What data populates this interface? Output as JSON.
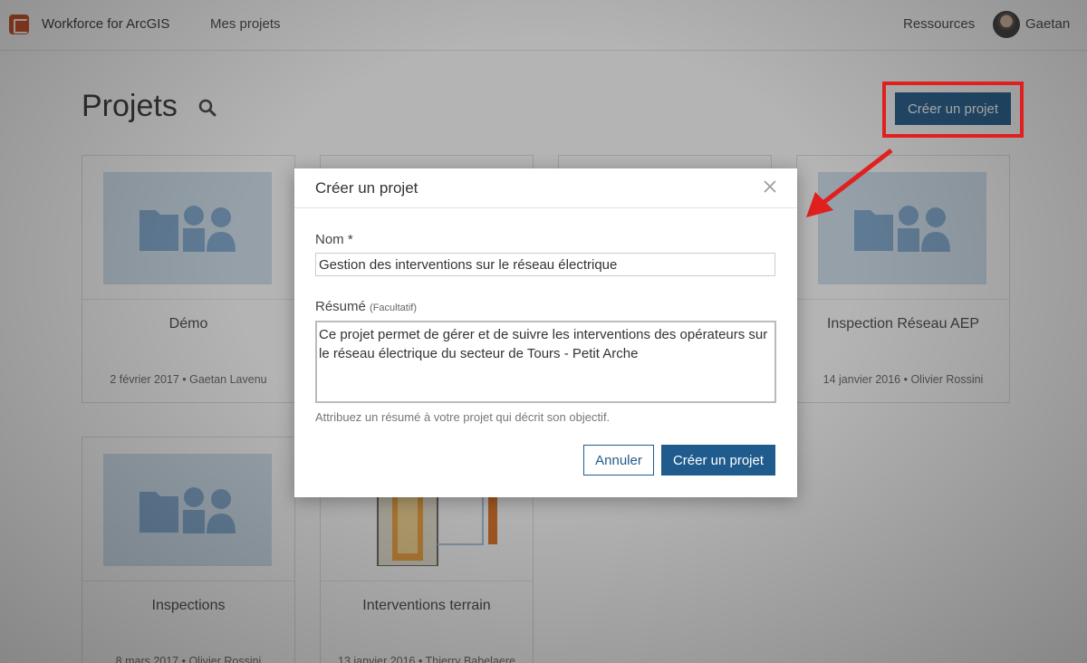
{
  "app": {
    "title": "Workforce for ArcGIS",
    "logo_icon": "workforce-logo-icon"
  },
  "nav": {
    "my_projects": "Mes projets",
    "resources": "Ressources",
    "user_name": "Gaetan"
  },
  "page": {
    "title": "Projets",
    "create_button": "Créer un projet"
  },
  "cards": [
    {
      "title": "Démo",
      "meta": "2 février 2017 • Gaetan Lavenu"
    },
    {
      "title": "Inspection Réseau AEP",
      "meta": "14 janvier 2016 • Olivier Rossini"
    },
    {
      "title": "Inspections",
      "meta": "8 mars 2017 • Olivier Rossini"
    },
    {
      "title": "Interventions terrain",
      "meta": "13 janvier 2016 • Thierry Babelaere"
    }
  ],
  "modal": {
    "title": "Créer un projet",
    "name_label": "Nom *",
    "name_value": "Gestion des interventions sur le réseau électrique",
    "summary_label": "Résumé",
    "summary_optional": "(Facultatif)",
    "summary_value": "Ce projet permet de gérer et de suivre les interventions des opérateurs sur le réseau électrique du secteur de Tours - Petit Arche",
    "help_text": "Attribuez un résumé à votre projet qui décrit son objectif.",
    "cancel_button": "Annuler",
    "create_button": "Créer un projet"
  },
  "colors": {
    "primary": "#1f5b8c",
    "annotation": "#e0201f",
    "thumb": "#cfe0ee",
    "logo": "#cc4a1d"
  }
}
